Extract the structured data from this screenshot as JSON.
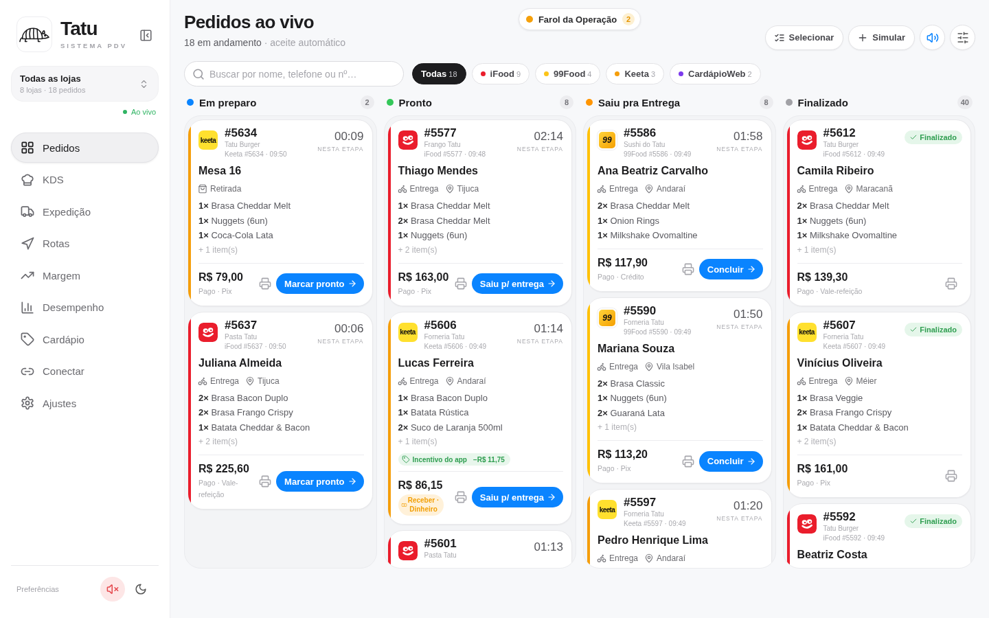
{
  "sidebar": {
    "brand": {
      "name": "Tatu",
      "tagline": "SISTEMA PDV"
    },
    "store_selector": {
      "title": "Todas as lojas",
      "subtitle": "8 lojas · 18 pedidos"
    },
    "live_label": "Ao vivo",
    "nav": [
      {
        "kind": "orders",
        "label": "Pedidos",
        "selected": true
      },
      {
        "kind": "kitchen",
        "label": "KDS",
        "selected": false
      },
      {
        "kind": "dispatch",
        "label": "Expedição",
        "selected": false
      },
      {
        "kind": "routes",
        "label": "Rotas",
        "selected": false
      },
      {
        "kind": "margin",
        "label": "Margem",
        "selected": false
      },
      {
        "kind": "performance",
        "label": "Desempenho",
        "selected": false
      },
      {
        "kind": "menu",
        "label": "Cardápio",
        "selected": false
      },
      {
        "kind": "connect",
        "label": "Conectar",
        "selected": false
      },
      {
        "kind": "settings",
        "label": "Ajustes",
        "selected": false
      }
    ],
    "footer": {
      "label": "Preferências",
      "muted": true
    }
  },
  "header": {
    "title": "Pedidos ao vivo",
    "count_text": "18 em andamento",
    "note": "· aceite automático",
    "alert": {
      "label": "Farol da Operação",
      "count": "2"
    },
    "actions": [
      {
        "kind": "select",
        "label": "Selecionar"
      },
      {
        "kind": "simulate",
        "label": "Simular"
      }
    ],
    "sound_on": true
  },
  "search": {
    "placeholder": "Buscar por nome, telefone ou nº…"
  },
  "filters": [
    {
      "label": "Todas",
      "count": "18",
      "selected": true
    },
    {
      "label": "iFood",
      "count": "9",
      "color": "#ea1d2c",
      "selected": false
    },
    {
      "label": "99Food",
      "count": "4",
      "color": "#fcc419",
      "selected": false
    },
    {
      "label": "Keeta",
      "count": "3",
      "color": "#f59e0b",
      "selected": false
    },
    {
      "label": "CardápioWeb",
      "count": "2",
      "color": "#7c3aed",
      "selected": false
    }
  ],
  "columns": [
    {
      "title": "Em preparo",
      "count": "2",
      "color": "#0a84ff",
      "cards": [
        {
          "number": "#5634",
          "kind": "keeta",
          "logo_text": "keeta",
          "color": "#f59e0b",
          "store": "Tatu Burger",
          "meta": "Keeta #5634 · 09:50",
          "timer": "00:09",
          "timer_label": "NESTA ETAPA",
          "customer": "Mesa 16",
          "mode": {
            "kind": "pickup",
            "label": "Retirada"
          },
          "items": [
            "**1×** Brasa Cheddar Melt",
            "**1×** Nuggets (6un)",
            "**1×** Coca-Cola Lata"
          ],
          "more": "+ 1 item(s)",
          "total": "R$ 79,00",
          "payment": {
            "kind": "paid",
            "text": "Pago · Pix"
          },
          "action": "Marcar pronto"
        },
        {
          "number": "#5637",
          "kind": "ifood",
          "color": "#ea1d2c",
          "store": "Pasta Tatu",
          "meta": "iFood #5637 · 09:50",
          "timer": "00:06",
          "timer_label": "NESTA ETAPA",
          "customer": "Juliana Almeida",
          "mode": {
            "kind": "delivery",
            "label": "Entrega"
          },
          "place": "Tijuca",
          "items": [
            "**2×** Brasa Bacon Duplo",
            "**2×** Brasa Frango Crispy",
            "**1×** Batata Cheddar & Bacon"
          ],
          "more": "+ 2 item(s)",
          "total": "R$ 225,60",
          "payment": {
            "kind": "paid",
            "text": "Pago · Vale-refeição"
          },
          "action": "Marcar pronto"
        }
      ]
    },
    {
      "title": "Pronto",
      "count": "8",
      "color": "#34c759",
      "cards": [
        {
          "number": "#5577",
          "kind": "ifood",
          "color": "#ea1d2c",
          "store": "Frango Tatu",
          "meta": "iFood #5577 · 09:48",
          "timer": "02:14",
          "timer_label": "NESTA ETAPA",
          "customer": "Thiago Mendes",
          "mode": {
            "kind": "delivery",
            "label": "Entrega"
          },
          "place": "Tijuca",
          "items": [
            "**1×** Brasa Cheddar Melt",
            "**2×** Brasa Cheddar Melt",
            "**1×** Nuggets (6un)"
          ],
          "more": "+ 2 item(s)",
          "total": "R$ 163,00",
          "payment": {
            "kind": "paid",
            "text": "Pago · Pix"
          },
          "action": "Saiu p/ entrega"
        },
        {
          "number": "#5606",
          "kind": "keeta",
          "logo_text": "keeta",
          "color": "#f59e0b",
          "store": "Forneria Tatu",
          "meta": "Keeta #5606 · 09:49",
          "timer": "01:14",
          "timer_label": "NESTA ETAPA",
          "customer": "Lucas Ferreira",
          "mode": {
            "kind": "delivery",
            "label": "Entrega"
          },
          "place": "Andaraí",
          "items": [
            "**1×** Brasa Bacon Duplo",
            "**1×** Batata Rústica",
            "**2×** Suco de Laranja 500ml"
          ],
          "more": "+ 1 item(s)",
          "incentive": {
            "label": "Incentivo do app",
            "amount": "−R$ 11,75"
          },
          "total": "R$ 86,15",
          "payment": {
            "kind": "collect",
            "text": "Receber · Dinheiro"
          },
          "action": "Saiu p/ entrega"
        },
        {
          "number": "#5601",
          "kind": "ifood",
          "color": "#ea1d2c",
          "store": "Pasta Tatu",
          "timer": "01:13"
        }
      ]
    },
    {
      "title": "Saiu pra Entrega",
      "count": "8",
      "color": "#ff9500",
      "cards": [
        {
          "number": "#5586",
          "kind": "ninetynine",
          "logo_text": "99",
          "color": "#ffc107",
          "store": "Sushi do Tatu",
          "meta": "99Food #5586 · 09:49",
          "timer": "01:58",
          "timer_label": "NESTA ETAPA",
          "customer": "Ana Beatriz Carvalho",
          "mode": {
            "kind": "delivery",
            "label": "Entrega"
          },
          "place": "Andaraí",
          "items": [
            "**2×** Brasa Cheddar Melt",
            "**1×** Onion Rings",
            "**1×** Milkshake Ovomaltine"
          ],
          "total": "R$ 117,90",
          "payment": {
            "kind": "paid",
            "text": "Pago · Crédito"
          },
          "action": "Concluir"
        },
        {
          "number": "#5590",
          "kind": "ninetynine",
          "logo_text": "99",
          "color": "#ffc107",
          "store": "Forneria Tatu",
          "meta": "99Food #5590 · 09:49",
          "timer": "01:50",
          "timer_label": "NESTA ETAPA",
          "customer": "Mariana Souza",
          "mode": {
            "kind": "delivery",
            "label": "Entrega"
          },
          "place": "Vila Isabel",
          "items": [
            "**2×** Brasa Classic",
            "**1×** Nuggets (6un)",
            "**2×** Guaraná Lata"
          ],
          "more": "+ 1 item(s)",
          "total": "R$ 113,20",
          "payment": {
            "kind": "paid",
            "text": "Pago · Pix"
          },
          "action": "Concluir"
        },
        {
          "number": "#5597",
          "kind": "keeta",
          "logo_text": "keeta",
          "color": "#f59e0b",
          "store": "Forneria Tatu",
          "meta": "Keeta #5597 · 09:49",
          "timer": "01:20",
          "timer_label": "NESTA ETAPA",
          "customer": "Pedro Henrique Lima",
          "mode": {
            "kind": "delivery",
            "label": "Entrega"
          },
          "place": "Andaraí"
        }
      ]
    },
    {
      "title": "Finalizado",
      "count": "40",
      "color": "#a1a1a6",
      "cards": [
        {
          "number": "#5612",
          "kind": "ifood",
          "color": "#ea1d2c",
          "store": "Tatu Burger",
          "meta": "iFood #5612 · 09:49",
          "status": "Finalizado",
          "customer": "Camila Ribeiro",
          "mode": {
            "kind": "delivery",
            "label": "Entrega"
          },
          "place": "Maracanã",
          "items": [
            "**2×** Brasa Cheddar Melt",
            "**1×** Nuggets (6un)",
            "**1×** Milkshake Ovomaltine"
          ],
          "more": "+ 1 item(s)",
          "total": "R$ 139,30",
          "payment": {
            "kind": "paid",
            "text": "Pago · Vale-refeição"
          }
        },
        {
          "number": "#5607",
          "kind": "keeta",
          "logo_text": "keeta",
          "color": "#f59e0b",
          "store": "Forneria Tatu",
          "meta": "Keeta #5607 · 09:49",
          "status": "Finalizado",
          "customer": "Vinícius Oliveira",
          "mode": {
            "kind": "delivery",
            "label": "Entrega"
          },
          "place": "Méier",
          "items": [
            "**1×** Brasa Veggie",
            "**2×** Brasa Frango Crispy",
            "**1×** Batata Cheddar & Bacon"
          ],
          "more": "+ 2 item(s)",
          "total": "R$ 161,00",
          "payment": {
            "kind": "paid",
            "text": "Pago · Pix"
          }
        },
        {
          "number": "#5592",
          "kind": "ifood",
          "color": "#ea1d2c",
          "store": "Tatu Burger",
          "meta": "iFood #5592 · 09:49",
          "status": "Finalizado",
          "customer": "Beatriz Costa"
        }
      ]
    }
  ]
}
